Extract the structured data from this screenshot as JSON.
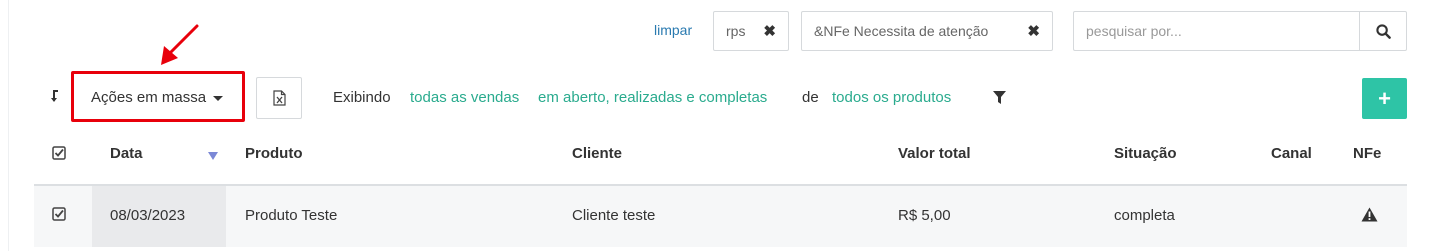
{
  "filters": {
    "clear_label": "limpar",
    "chips": [
      {
        "label": "rps",
        "remove": "✖"
      },
      {
        "label": "&NFe Necessita de atenção",
        "remove": "✖"
      }
    ],
    "search_placeholder": "pesquisar por..."
  },
  "toolbar": {
    "bulk_actions_label": "Ações em massa",
    "showing_label": "Exibindo",
    "sales_filter": "todas as vendas",
    "status_filter": "em aberto, realizadas e completas",
    "of_label": "de",
    "products_filter": "todos os produtos",
    "add_label": "+"
  },
  "table": {
    "columns": [
      "Data",
      "Produto",
      "Cliente",
      "Valor total",
      "Situação",
      "Canal",
      "NFe"
    ],
    "rows": [
      {
        "date": "08/03/2023",
        "product": "Produto Teste",
        "client": "Cliente teste",
        "total": "R$ 5,00",
        "status": "completa",
        "channel": "",
        "checked": true
      }
    ]
  },
  "colors": {
    "accent_green": "#2ec4a6",
    "link_green": "#2aab8e",
    "link_blue": "#2a7ab0",
    "annotation_red": "#e8000b",
    "sort_indicator": "#7b88d6"
  },
  "icons": [
    "sort-icon",
    "excel-file-icon",
    "filter-icon",
    "search-icon",
    "checkbox-icon",
    "warning-icon",
    "annotation-arrow-icon"
  ]
}
